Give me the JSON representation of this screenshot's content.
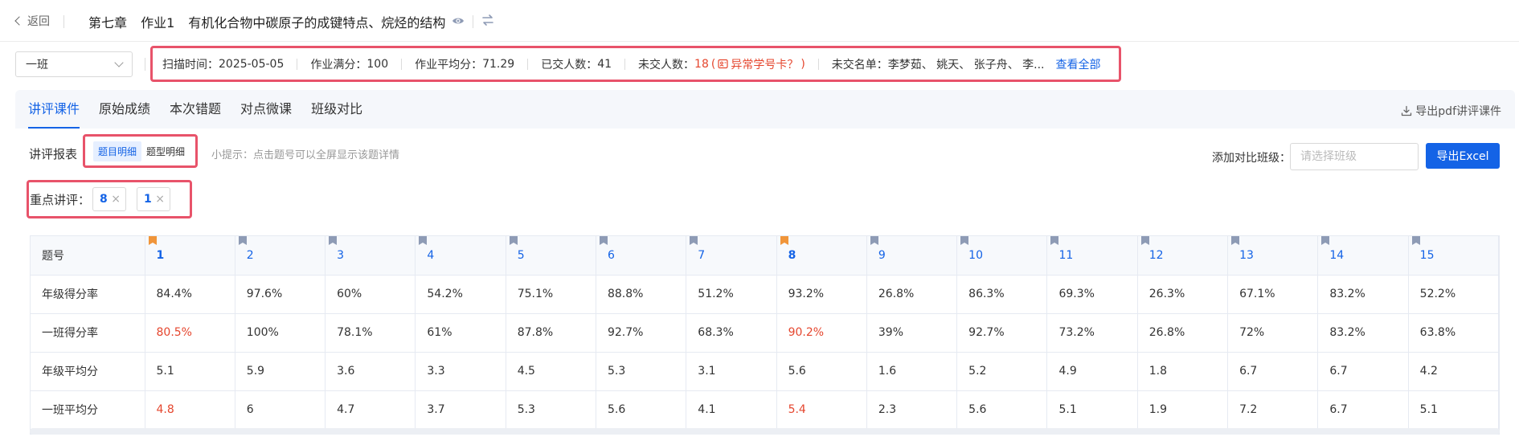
{
  "header": {
    "back_label": "返回",
    "chapter": "第七章",
    "homework": "作业1",
    "topic": "有机化合物中碳原子的成键特点、烷烃的结构"
  },
  "info_bar": {
    "class_selected": "一班",
    "scan_time_label": "扫描时间：",
    "scan_time": "2025-05-05",
    "full_score_label": "作业满分：",
    "full_score": "100",
    "avg_label": "作业平均分：",
    "avg": "71.29",
    "submitted_label": "已交人数：",
    "submitted": "41",
    "unsubmitted_label": "未交人数：",
    "unsubmitted": "18",
    "abnormal_open": "(",
    "abnormal_text": "异常学号卡？",
    "abnormal_close": ")",
    "unsubmitted_names_label": "未交名单：",
    "unsubmitted_names": "李梦茹、 姚天、 张子舟、 李...",
    "view_all": "查看全部"
  },
  "tabs": [
    "讲评课件",
    "原始成绩",
    "本次错题",
    "对点微课",
    "班级对比"
  ],
  "export_pdf": "导出pdf讲评课件",
  "report": {
    "label": "讲评报表",
    "modes": [
      "题目明细",
      "题型明细"
    ],
    "tip": "小提示：点击题号可以全屏显示该题详情",
    "compare_label": "添加对比班级：",
    "compare_placeholder": "请选择班级",
    "export_excel": "导出Excel"
  },
  "focus": {
    "label": "重点讲评：",
    "chips": [
      "8",
      "1"
    ]
  },
  "table": {
    "header_label": "题号",
    "questions": [
      "1",
      "2",
      "3",
      "4",
      "5",
      "6",
      "7",
      "8",
      "9",
      "10",
      "11",
      "12",
      "13",
      "14",
      "15"
    ],
    "flag_colors": {
      "focus": "#f0953a",
      "normal": "#8e9bb5"
    },
    "focus_questions": [
      "1",
      "8"
    ],
    "rows": [
      {
        "label": "年级得分率",
        "values": [
          "84.4%",
          "97.6%",
          "60%",
          "54.2%",
          "75.1%",
          "88.8%",
          "51.2%",
          "93.2%",
          "26.8%",
          "86.3%",
          "69.3%",
          "26.3%",
          "67.1%",
          "83.2%",
          "52.2%"
        ],
        "red": []
      },
      {
        "label": "一班得分率",
        "values": [
          "80.5%",
          "100%",
          "78.1%",
          "61%",
          "87.8%",
          "92.7%",
          "68.3%",
          "90.2%",
          "39%",
          "92.7%",
          "73.2%",
          "26.8%",
          "72%",
          "83.2%",
          "63.8%"
        ],
        "red": [
          0,
          7
        ]
      },
      {
        "label": "年级平均分",
        "values": [
          "5.1",
          "5.9",
          "3.6",
          "3.3",
          "4.5",
          "5.3",
          "3.1",
          "5.6",
          "1.6",
          "5.2",
          "4.9",
          "1.8",
          "6.7",
          "6.7",
          "4.2"
        ],
        "red": []
      },
      {
        "label": "一班平均分",
        "values": [
          "4.8",
          "6",
          "4.7",
          "3.7",
          "5.3",
          "5.6",
          "4.1",
          "5.4",
          "2.3",
          "5.6",
          "5.1",
          "1.9",
          "7.2",
          "6.7",
          "5.1"
        ],
        "red": [
          0,
          7
        ]
      }
    ]
  },
  "colors": {
    "accent": "#1463e6",
    "highlight_border": "#e8536a",
    "warning_text": "#e5462e"
  }
}
